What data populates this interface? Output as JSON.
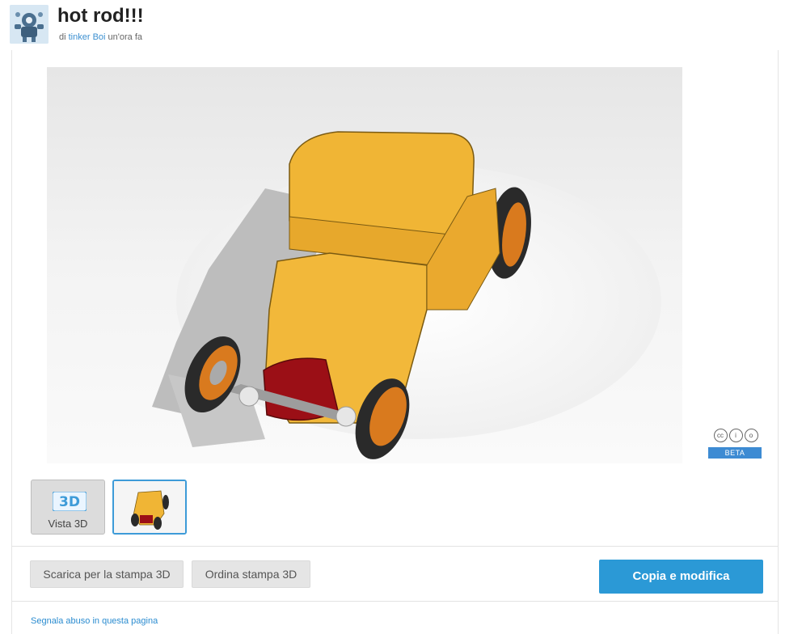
{
  "design": {
    "title": "hot rod!!!",
    "byline_prefix": "di",
    "author": "tinker Boi",
    "time_ago": "un'ora fa"
  },
  "viewer": {
    "license_icons": [
      "cc-icon",
      "attribution-icon",
      "share-alike-icon"
    ],
    "license_icon_glyphs": [
      "cc",
      "i",
      "o"
    ],
    "beta_label": "BETA"
  },
  "thumbnails": {
    "view3d_logo": "3D",
    "view3d_label": "Vista 3D"
  },
  "actions": {
    "download_label": "Scarica per la stampa 3D",
    "order_label": "Ordina stampa 3D",
    "copy_label": "Copia e modifica"
  },
  "footer": {
    "report_label": "Segnala abuso in questa pagina"
  },
  "colors": {
    "accent": "#2b99d6",
    "beta": "#3d8bd3",
    "car_body": "#f0b535",
    "car_grille": "#9b0f16",
    "wheel_rim": "#d97a1e"
  }
}
